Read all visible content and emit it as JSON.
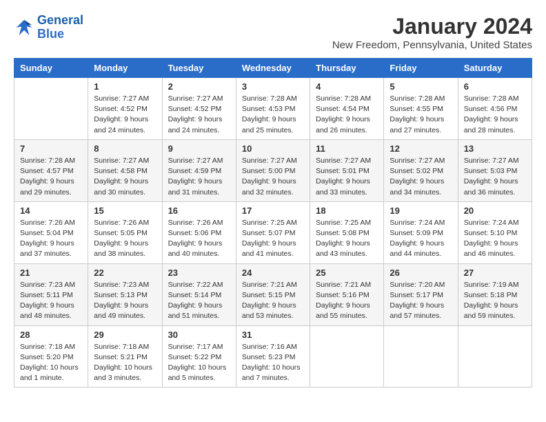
{
  "header": {
    "logo_line1": "General",
    "logo_line2": "Blue",
    "month_year": "January 2024",
    "location": "New Freedom, Pennsylvania, United States"
  },
  "weekdays": [
    "Sunday",
    "Monday",
    "Tuesday",
    "Wednesday",
    "Thursday",
    "Friday",
    "Saturday"
  ],
  "weeks": [
    [
      {
        "day": "",
        "info": ""
      },
      {
        "day": "1",
        "info": "Sunrise: 7:27 AM\nSunset: 4:52 PM\nDaylight: 9 hours\nand 24 minutes."
      },
      {
        "day": "2",
        "info": "Sunrise: 7:27 AM\nSunset: 4:52 PM\nDaylight: 9 hours\nand 24 minutes."
      },
      {
        "day": "3",
        "info": "Sunrise: 7:28 AM\nSunset: 4:53 PM\nDaylight: 9 hours\nand 25 minutes."
      },
      {
        "day": "4",
        "info": "Sunrise: 7:28 AM\nSunset: 4:54 PM\nDaylight: 9 hours\nand 26 minutes."
      },
      {
        "day": "5",
        "info": "Sunrise: 7:28 AM\nSunset: 4:55 PM\nDaylight: 9 hours\nand 27 minutes."
      },
      {
        "day": "6",
        "info": "Sunrise: 7:28 AM\nSunset: 4:56 PM\nDaylight: 9 hours\nand 28 minutes."
      }
    ],
    [
      {
        "day": "7",
        "info": "Sunrise: 7:28 AM\nSunset: 4:57 PM\nDaylight: 9 hours\nand 29 minutes."
      },
      {
        "day": "8",
        "info": "Sunrise: 7:27 AM\nSunset: 4:58 PM\nDaylight: 9 hours\nand 30 minutes."
      },
      {
        "day": "9",
        "info": "Sunrise: 7:27 AM\nSunset: 4:59 PM\nDaylight: 9 hours\nand 31 minutes."
      },
      {
        "day": "10",
        "info": "Sunrise: 7:27 AM\nSunset: 5:00 PM\nDaylight: 9 hours\nand 32 minutes."
      },
      {
        "day": "11",
        "info": "Sunrise: 7:27 AM\nSunset: 5:01 PM\nDaylight: 9 hours\nand 33 minutes."
      },
      {
        "day": "12",
        "info": "Sunrise: 7:27 AM\nSunset: 5:02 PM\nDaylight: 9 hours\nand 34 minutes."
      },
      {
        "day": "13",
        "info": "Sunrise: 7:27 AM\nSunset: 5:03 PM\nDaylight: 9 hours\nand 36 minutes."
      }
    ],
    [
      {
        "day": "14",
        "info": "Sunrise: 7:26 AM\nSunset: 5:04 PM\nDaylight: 9 hours\nand 37 minutes."
      },
      {
        "day": "15",
        "info": "Sunrise: 7:26 AM\nSunset: 5:05 PM\nDaylight: 9 hours\nand 38 minutes."
      },
      {
        "day": "16",
        "info": "Sunrise: 7:26 AM\nSunset: 5:06 PM\nDaylight: 9 hours\nand 40 minutes."
      },
      {
        "day": "17",
        "info": "Sunrise: 7:25 AM\nSunset: 5:07 PM\nDaylight: 9 hours\nand 41 minutes."
      },
      {
        "day": "18",
        "info": "Sunrise: 7:25 AM\nSunset: 5:08 PM\nDaylight: 9 hours\nand 43 minutes."
      },
      {
        "day": "19",
        "info": "Sunrise: 7:24 AM\nSunset: 5:09 PM\nDaylight: 9 hours\nand 44 minutes."
      },
      {
        "day": "20",
        "info": "Sunrise: 7:24 AM\nSunset: 5:10 PM\nDaylight: 9 hours\nand 46 minutes."
      }
    ],
    [
      {
        "day": "21",
        "info": "Sunrise: 7:23 AM\nSunset: 5:11 PM\nDaylight: 9 hours\nand 48 minutes."
      },
      {
        "day": "22",
        "info": "Sunrise: 7:23 AM\nSunset: 5:13 PM\nDaylight: 9 hours\nand 49 minutes."
      },
      {
        "day": "23",
        "info": "Sunrise: 7:22 AM\nSunset: 5:14 PM\nDaylight: 9 hours\nand 51 minutes."
      },
      {
        "day": "24",
        "info": "Sunrise: 7:21 AM\nSunset: 5:15 PM\nDaylight: 9 hours\nand 53 minutes."
      },
      {
        "day": "25",
        "info": "Sunrise: 7:21 AM\nSunset: 5:16 PM\nDaylight: 9 hours\nand 55 minutes."
      },
      {
        "day": "26",
        "info": "Sunrise: 7:20 AM\nSunset: 5:17 PM\nDaylight: 9 hours\nand 57 minutes."
      },
      {
        "day": "27",
        "info": "Sunrise: 7:19 AM\nSunset: 5:18 PM\nDaylight: 9 hours\nand 59 minutes."
      }
    ],
    [
      {
        "day": "28",
        "info": "Sunrise: 7:18 AM\nSunset: 5:20 PM\nDaylight: 10 hours\nand 1 minute."
      },
      {
        "day": "29",
        "info": "Sunrise: 7:18 AM\nSunset: 5:21 PM\nDaylight: 10 hours\nand 3 minutes."
      },
      {
        "day": "30",
        "info": "Sunrise: 7:17 AM\nSunset: 5:22 PM\nDaylight: 10 hours\nand 5 minutes."
      },
      {
        "day": "31",
        "info": "Sunrise: 7:16 AM\nSunset: 5:23 PM\nDaylight: 10 hours\nand 7 minutes."
      },
      {
        "day": "",
        "info": ""
      },
      {
        "day": "",
        "info": ""
      },
      {
        "day": "",
        "info": ""
      }
    ]
  ]
}
